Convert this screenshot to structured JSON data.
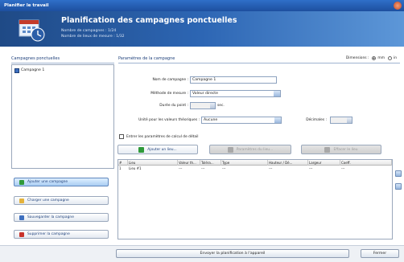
{
  "window": {
    "title": "Planifier le travail"
  },
  "banner": {
    "title": "Planification des campagnes ponctuelles",
    "line1": "Nombre de campagnes : 1/24",
    "line2": "Nombre de lieux de mesure : 1/32"
  },
  "left": {
    "header": "Campagnes ponctuelles",
    "tree_item": "Campagne 1",
    "buttons": [
      "Ajouter une campagne",
      "Charger une campagne",
      "Sauvegarder la campagne",
      "Supprimer la campagne"
    ]
  },
  "right": {
    "header": "Paramètres de la campagne",
    "dims_label": "Dimensions :",
    "dims_opt1": "mm",
    "dims_opt2": "in",
    "fields": {
      "name_label": "Nom de campagne :",
      "name_value": "Campagne 1",
      "method_label": "Méthode de mesure :",
      "method_value": "Valeur directe",
      "duration_label": "Durée du point :",
      "duration_value": "",
      "duration_unit": "sec.",
      "unit_label": "Unité pour les valeurs théoriques :",
      "unit_value": "Aucune",
      "decimals_label": "Décimales :",
      "decimals_value": ""
    },
    "checkbox_label": "Entrer les paramètres de calcul de détail",
    "toolbar": {
      "add_label": "Ajouter un lieu...",
      "edit_label": "Paramètres du lieu...",
      "delete_label": "Effacer le lieu"
    },
    "table": {
      "columns": [
        "#",
        "Lieu",
        "Valeur th...",
        "Toléra...",
        "Type",
        "Hauteur / Dé...",
        "Largeur",
        "Coeff."
      ],
      "rows": [
        [
          "1",
          "Lieu #1",
          "---",
          "---",
          "---",
          "---",
          "---",
          "---"
        ]
      ]
    }
  },
  "footer": {
    "send_label": "Envoyer la planification à l'appareil",
    "close_label": "Fermer"
  }
}
